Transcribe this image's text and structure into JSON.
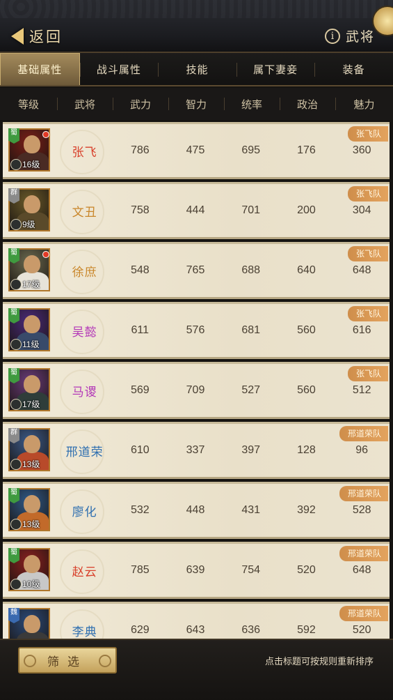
{
  "header": {
    "back_label": "返回",
    "title": "武将",
    "info_icon": "info-icon"
  },
  "tabs": [
    {
      "label": "基础属性",
      "active": true
    },
    {
      "label": "战斗属性",
      "active": false
    },
    {
      "label": "技能",
      "active": false
    },
    {
      "label": "属下妻妾",
      "active": false
    },
    {
      "label": "装备",
      "active": false
    }
  ],
  "columns": [
    "等级",
    "武将",
    "武力",
    "智力",
    "统率",
    "政治",
    "魅力"
  ],
  "generals": [
    {
      "faction": "蜀",
      "faction_color": "#3f9a3f",
      "level": "16级",
      "red_dot": true,
      "name": "张飞",
      "name_color": "#d8402b",
      "bg": "#7a1f18",
      "armor": "#4a2b24",
      "stats": [
        "786",
        "475",
        "695",
        "176",
        "360"
      ],
      "team": "张飞队"
    },
    {
      "faction": "群",
      "faction_color": "#8a8a8a",
      "level": "9级",
      "red_dot": false,
      "name": "文丑",
      "name_color": "#c9862a",
      "bg": "#6a5a2a",
      "armor": "#5a4a2a",
      "stats": [
        "758",
        "444",
        "701",
        "200",
        "304"
      ],
      "team": "张飞队"
    },
    {
      "faction": "蜀",
      "faction_color": "#3f9a3f",
      "level": "17级",
      "red_dot": true,
      "name": "徐庶",
      "name_color": "#c9862a",
      "bg": "#6b6a50",
      "armor": "#e7e3d9",
      "stats": [
        "548",
        "765",
        "688",
        "640",
        "648"
      ],
      "team": "张飞队"
    },
    {
      "faction": "蜀",
      "faction_color": "#3f9a3f",
      "level": "11级",
      "red_dot": false,
      "name": "吴懿",
      "name_color": "#b338b8",
      "bg": "#4a2a7a",
      "armor": "#384a6a",
      "stats": [
        "611",
        "576",
        "681",
        "560",
        "616"
      ],
      "team": "张飞队"
    },
    {
      "faction": "蜀",
      "faction_color": "#3f9a3f",
      "level": "17级",
      "red_dot": false,
      "name": "马谡",
      "name_color": "#b338b8",
      "bg": "#6a3b7a",
      "armor": "#2f3d3a",
      "stats": [
        "569",
        "709",
        "527",
        "560",
        "512"
      ],
      "team": "张飞队"
    },
    {
      "faction": "群",
      "faction_color": "#8a8a8a",
      "level": "13级",
      "red_dot": false,
      "name": "邢道荣",
      "name_color": "#2f6fb0",
      "bg": "#3a5a8a",
      "armor": "#b84a2a",
      "stats": [
        "610",
        "337",
        "397",
        "128",
        "96"
      ],
      "team": "邢道荣队"
    },
    {
      "faction": "蜀",
      "faction_color": "#3f9a3f",
      "level": "13级",
      "red_dot": false,
      "name": "廖化",
      "name_color": "#2f6fb0",
      "bg": "#2f5a8a",
      "armor": "#c26a2a",
      "stats": [
        "532",
        "448",
        "431",
        "392",
        "528"
      ],
      "team": "邢道荣队"
    },
    {
      "faction": "蜀",
      "faction_color": "#3f9a3f",
      "level": "10级",
      "red_dot": false,
      "name": "赵云",
      "name_color": "#d8402b",
      "bg": "#8a2020",
      "armor": "#c8c8c8",
      "stats": [
        "785",
        "639",
        "754",
        "520",
        "648"
      ],
      "team": "邢道荣队"
    },
    {
      "faction": "魏",
      "faction_color": "#3a6ab0",
      "level": "",
      "red_dot": false,
      "name": "李典",
      "name_color": "#2f6fb0",
      "bg": "#2a4a7a",
      "armor": "#3a3a3a",
      "stats": [
        "629",
        "643",
        "636",
        "592",
        "520"
      ],
      "team": "邢道荣队"
    }
  ],
  "footer": {
    "filter_label": "筛选",
    "hint": "点击标题可按规则重新排序"
  }
}
